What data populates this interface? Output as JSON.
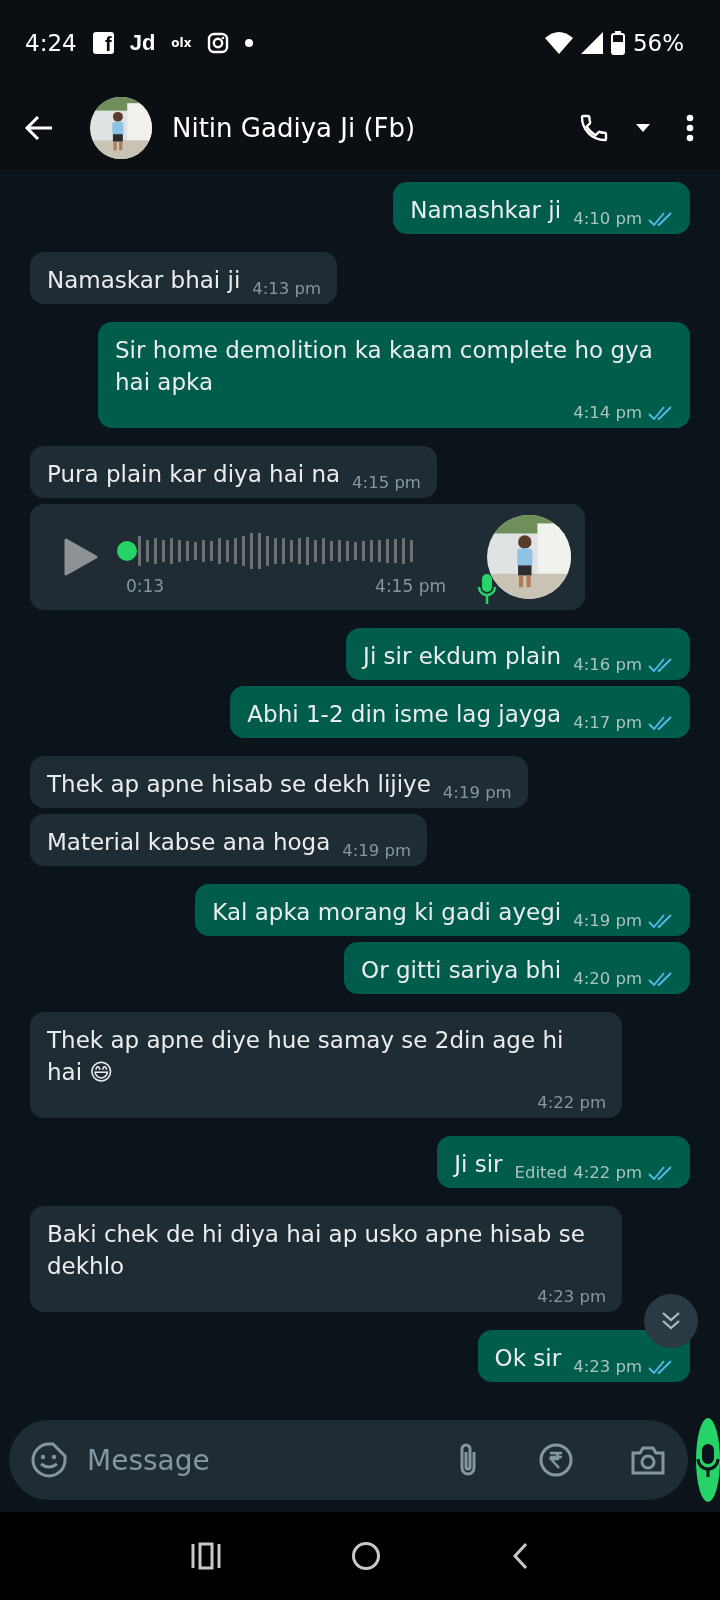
{
  "status_bar": {
    "time": "4:24",
    "app_icons": [
      {
        "kind": "facebook",
        "label": "f"
      },
      {
        "kind": "text",
        "label": "Jd"
      },
      {
        "kind": "small_text",
        "label": "olx"
      },
      {
        "kind": "instagram"
      },
      {
        "kind": "dot"
      }
    ],
    "battery": "56%"
  },
  "header": {
    "contact_name": "Nitin Gadiya Ji (Fb)"
  },
  "messages": [
    {
      "kind": "text",
      "outgoing": true,
      "text": "Namashkar ji",
      "time": "4:10 pm",
      "read": true
    },
    {
      "kind": "text",
      "outgoing": false,
      "text": "Namaskar bhai ji",
      "time": "4:13 pm"
    },
    {
      "kind": "text",
      "outgoing": true,
      "text": "Sir home demolition ka kaam complete ho gya hai apka",
      "time": "4:14 pm",
      "read": true
    },
    {
      "kind": "text",
      "outgoing": false,
      "text": "Pura plain kar diya hai na",
      "time": "4:15 pm"
    },
    {
      "kind": "voice",
      "outgoing": false,
      "duration": "0:13",
      "time": "4:15 pm"
    },
    {
      "kind": "text",
      "outgoing": true,
      "text": "Ji sir ekdum plain",
      "time": "4:16 pm",
      "read": true
    },
    {
      "kind": "text",
      "outgoing": true,
      "text": "Abhi 1-2 din isme lag jayga",
      "time": "4:17 pm",
      "read": true
    },
    {
      "kind": "text",
      "outgoing": false,
      "text": "Thek ap apne hisab se dekh lijiye",
      "time": "4:19 pm"
    },
    {
      "kind": "text",
      "outgoing": false,
      "text": "Material kabse ana hoga",
      "time": "4:19 pm"
    },
    {
      "kind": "text",
      "outgoing": true,
      "text": "Kal apka morang ki gadi ayegi",
      "time": "4:19 pm",
      "read": true
    },
    {
      "kind": "text",
      "outgoing": true,
      "text": "Or gitti sariya bhi",
      "time": "4:20 pm",
      "read": true
    },
    {
      "kind": "text",
      "outgoing": false,
      "text": "Thek ap apne diye hue samay se 2din age hi hai 😄",
      "time": "4:22 pm"
    },
    {
      "kind": "text",
      "outgoing": true,
      "text": "Ji sir",
      "edited": "Edited",
      "time": "4:22 pm",
      "read": true
    },
    {
      "kind": "text",
      "outgoing": false,
      "text": "Baki chek de hi diya hai ap usko apne hisab se dekhlo",
      "time": "4:23 pm"
    },
    {
      "kind": "text",
      "outgoing": true,
      "text": "Ok sir",
      "time": "4:23 pm",
      "read": true
    }
  ],
  "composer": {
    "placeholder": "Message"
  }
}
